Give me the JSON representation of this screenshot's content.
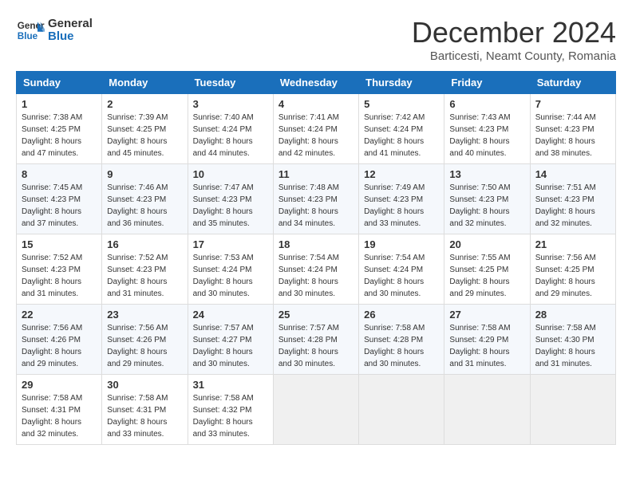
{
  "logo": {
    "line1": "General",
    "line2": "Blue"
  },
  "title": "December 2024",
  "location": "Barticesti, Neamt County, Romania",
  "headers": [
    "Sunday",
    "Monday",
    "Tuesday",
    "Wednesday",
    "Thursday",
    "Friday",
    "Saturday"
  ],
  "weeks": [
    [
      {
        "day": "1",
        "sunrise": "7:38 AM",
        "sunset": "4:25 PM",
        "daylight": "8 hours and 47 minutes."
      },
      {
        "day": "2",
        "sunrise": "7:39 AM",
        "sunset": "4:25 PM",
        "daylight": "8 hours and 45 minutes."
      },
      {
        "day": "3",
        "sunrise": "7:40 AM",
        "sunset": "4:24 PM",
        "daylight": "8 hours and 44 minutes."
      },
      {
        "day": "4",
        "sunrise": "7:41 AM",
        "sunset": "4:24 PM",
        "daylight": "8 hours and 42 minutes."
      },
      {
        "day": "5",
        "sunrise": "7:42 AM",
        "sunset": "4:24 PM",
        "daylight": "8 hours and 41 minutes."
      },
      {
        "day": "6",
        "sunrise": "7:43 AM",
        "sunset": "4:23 PM",
        "daylight": "8 hours and 40 minutes."
      },
      {
        "day": "7",
        "sunrise": "7:44 AM",
        "sunset": "4:23 PM",
        "daylight": "8 hours and 38 minutes."
      }
    ],
    [
      {
        "day": "8",
        "sunrise": "7:45 AM",
        "sunset": "4:23 PM",
        "daylight": "8 hours and 37 minutes."
      },
      {
        "day": "9",
        "sunrise": "7:46 AM",
        "sunset": "4:23 PM",
        "daylight": "8 hours and 36 minutes."
      },
      {
        "day": "10",
        "sunrise": "7:47 AM",
        "sunset": "4:23 PM",
        "daylight": "8 hours and 35 minutes."
      },
      {
        "day": "11",
        "sunrise": "7:48 AM",
        "sunset": "4:23 PM",
        "daylight": "8 hours and 34 minutes."
      },
      {
        "day": "12",
        "sunrise": "7:49 AM",
        "sunset": "4:23 PM",
        "daylight": "8 hours and 33 minutes."
      },
      {
        "day": "13",
        "sunrise": "7:50 AM",
        "sunset": "4:23 PM",
        "daylight": "8 hours and 32 minutes."
      },
      {
        "day": "14",
        "sunrise": "7:51 AM",
        "sunset": "4:23 PM",
        "daylight": "8 hours and 32 minutes."
      }
    ],
    [
      {
        "day": "15",
        "sunrise": "7:52 AM",
        "sunset": "4:23 PM",
        "daylight": "8 hours and 31 minutes."
      },
      {
        "day": "16",
        "sunrise": "7:52 AM",
        "sunset": "4:23 PM",
        "daylight": "8 hours and 31 minutes."
      },
      {
        "day": "17",
        "sunrise": "7:53 AM",
        "sunset": "4:24 PM",
        "daylight": "8 hours and 30 minutes."
      },
      {
        "day": "18",
        "sunrise": "7:54 AM",
        "sunset": "4:24 PM",
        "daylight": "8 hours and 30 minutes."
      },
      {
        "day": "19",
        "sunrise": "7:54 AM",
        "sunset": "4:24 PM",
        "daylight": "8 hours and 30 minutes."
      },
      {
        "day": "20",
        "sunrise": "7:55 AM",
        "sunset": "4:25 PM",
        "daylight": "8 hours and 29 minutes."
      },
      {
        "day": "21",
        "sunrise": "7:56 AM",
        "sunset": "4:25 PM",
        "daylight": "8 hours and 29 minutes."
      }
    ],
    [
      {
        "day": "22",
        "sunrise": "7:56 AM",
        "sunset": "4:26 PM",
        "daylight": "8 hours and 29 minutes."
      },
      {
        "day": "23",
        "sunrise": "7:56 AM",
        "sunset": "4:26 PM",
        "daylight": "8 hours and 29 minutes."
      },
      {
        "day": "24",
        "sunrise": "7:57 AM",
        "sunset": "4:27 PM",
        "daylight": "8 hours and 30 minutes."
      },
      {
        "day": "25",
        "sunrise": "7:57 AM",
        "sunset": "4:28 PM",
        "daylight": "8 hours and 30 minutes."
      },
      {
        "day": "26",
        "sunrise": "7:58 AM",
        "sunset": "4:28 PM",
        "daylight": "8 hours and 30 minutes."
      },
      {
        "day": "27",
        "sunrise": "7:58 AM",
        "sunset": "4:29 PM",
        "daylight": "8 hours and 31 minutes."
      },
      {
        "day": "28",
        "sunrise": "7:58 AM",
        "sunset": "4:30 PM",
        "daylight": "8 hours and 31 minutes."
      }
    ],
    [
      {
        "day": "29",
        "sunrise": "7:58 AM",
        "sunset": "4:31 PM",
        "daylight": "8 hours and 32 minutes."
      },
      {
        "day": "30",
        "sunrise": "7:58 AM",
        "sunset": "4:31 PM",
        "daylight": "8 hours and 33 minutes."
      },
      {
        "day": "31",
        "sunrise": "7:58 AM",
        "sunset": "4:32 PM",
        "daylight": "8 hours and 33 minutes."
      },
      null,
      null,
      null,
      null
    ]
  ]
}
